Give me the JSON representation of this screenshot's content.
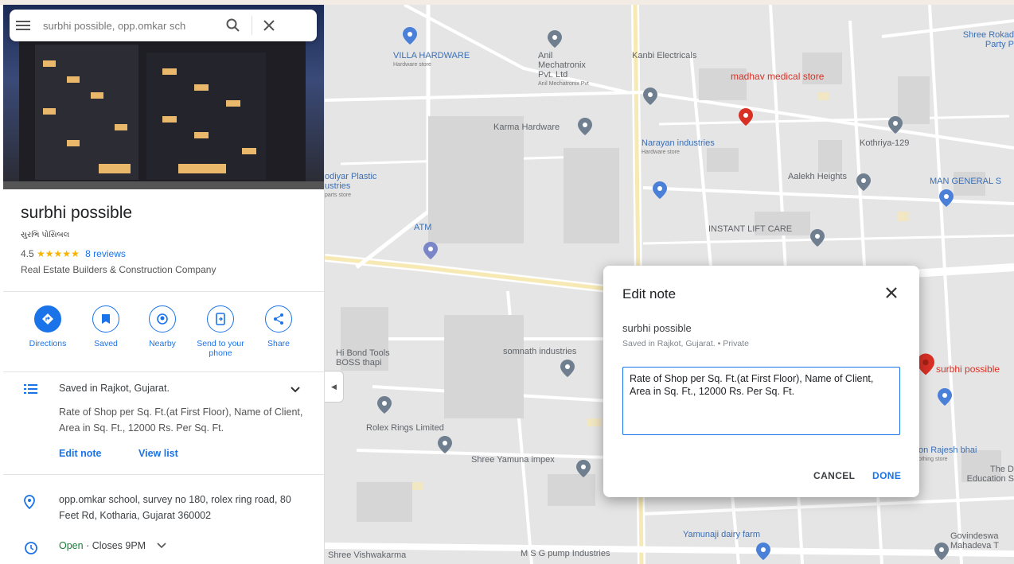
{
  "search": {
    "value": "surbhi possible, opp.omkar sch"
  },
  "place": {
    "name": "surbhi possible",
    "native_name": "સુરભિ પોસિબલ",
    "rating": "4.5",
    "stars": "★★★★★",
    "reviews": "8 reviews",
    "category": "Real Estate Builders & Construction Company"
  },
  "actions": [
    {
      "label": "Directions"
    },
    {
      "label": "Saved"
    },
    {
      "label": "Nearby"
    },
    {
      "label": "Send to your phone"
    },
    {
      "label": "Share"
    }
  ],
  "saved": {
    "title": "Saved in Rajkot, Gujarat.",
    "note": "Rate of Shop per Sq. Ft.(at First Floor), Name of Client, Area in Sq. Ft., 12000 Rs. Per Sq. Ft.",
    "edit_note": "Edit note",
    "view_list": "View list"
  },
  "address": "opp.omkar school, survey no 180, rolex ring road, 80 Feet Rd, Kotharia, Gujarat 360002",
  "hours": {
    "status": "Open",
    "closes": " · Closes 9PM"
  },
  "dialog": {
    "title": "Edit note",
    "place": "surbhi possible",
    "saved_in": "Saved in Rajkot, Gujarat. • Private",
    "note": "Rate of Shop per Sq. Ft.(at First Floor), Name of Client, Area in Sq. Ft., 12000 Rs. Per Sq. Ft.",
    "cancel": "CANCEL",
    "done": "DONE"
  },
  "map_labels": [
    {
      "name": "Shree Rokad Party P",
      "color": "blue"
    },
    {
      "name": "VILLA HARDWARE",
      "sub": "Hardware store",
      "color": "blue"
    },
    {
      "name": "Anil Mechatronix Pvt. Ltd",
      "sub": "Anil Mechatronix Pvt",
      "color": "gray"
    },
    {
      "name": "Kanbi Electricals",
      "color": "gray"
    },
    {
      "name": "madhav medical store",
      "color": "red"
    },
    {
      "name": "Karma Hardware",
      "color": "gray"
    },
    {
      "name": "Kothriya-129",
      "color": "gray"
    },
    {
      "name": "Narayan industries",
      "sub": "Hardware store",
      "color": "blue"
    },
    {
      "name": "Aalekh Heights",
      "color": "gray"
    },
    {
      "name": "MAN GENERAL S",
      "color": "blue"
    },
    {
      "name": "odiyar Plastic ustries",
      "sub": "parts store",
      "color": "blue"
    },
    {
      "name": "ATM",
      "color": "blue"
    },
    {
      "name": "INSTANT LIFT CARE",
      "color": "gray"
    },
    {
      "name": "Hi Bond Tools BOSS thapi",
      "color": "gray"
    },
    {
      "name": "somnath industries",
      "color": "gray"
    },
    {
      "name": "Rolex Rings Limited",
      "color": "gray"
    },
    {
      "name": "Shree Yamuna impex",
      "color": "gray"
    },
    {
      "name": "surbhi possible",
      "color": "red"
    },
    {
      "name": "on Rajesh bhai",
      "sub": "othing store",
      "color": "blue"
    },
    {
      "name": "The D Education S",
      "color": "gray"
    },
    {
      "name": "Yamunaji dairy farm",
      "color": "blue"
    },
    {
      "name": "Govindeswa Mahadeva T",
      "color": "gray"
    },
    {
      "name": "Shree Vishwakarma",
      "color": "gray"
    },
    {
      "name": "M S G pump Industries",
      "color": "gray"
    }
  ],
  "colors": {
    "accent": "#1a73e8",
    "pin_red": "#d93025",
    "map_bg": "#e5e5e5"
  }
}
